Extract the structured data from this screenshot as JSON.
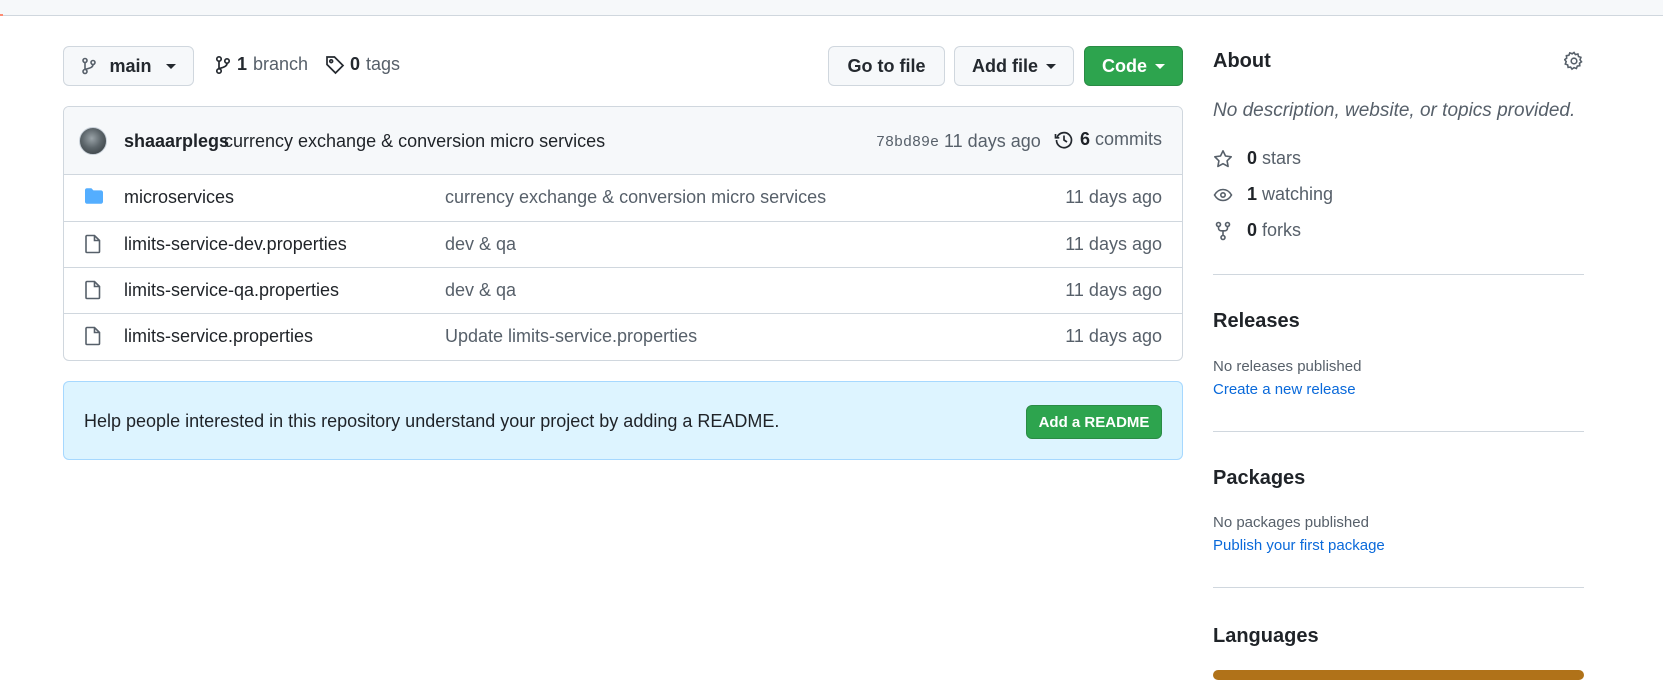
{
  "toolbar": {
    "branch_button": "main",
    "branches_count": "1",
    "branches_label": "branch",
    "tags_count": "0",
    "tags_label": "tags",
    "go_to_file": "Go to file",
    "add_file": "Add file",
    "code": "Code"
  },
  "commit": {
    "author": "shaaarplegs",
    "message": "currency exchange & conversion micro services",
    "sha": "78bd89e",
    "time": "11 days ago",
    "commits_count": "6",
    "commits_label": "commits"
  },
  "files": [
    {
      "name": "microservices",
      "type": "folder",
      "message": "currency exchange & conversion micro services",
      "time": "11 days ago"
    },
    {
      "name": "limits-service-dev.properties",
      "type": "file",
      "message": "dev & qa",
      "time": "11 days ago"
    },
    {
      "name": "limits-service-qa.properties",
      "type": "file",
      "message": "dev & qa",
      "time": "11 days ago"
    },
    {
      "name": "limits-service.properties",
      "type": "file",
      "message": "Update limits-service.properties",
      "time": "11 days ago"
    }
  ],
  "readme_banner": {
    "text": "Help people interested in this repository understand your project by adding a README.",
    "button": "Add a README"
  },
  "sidebar": {
    "about_title": "About",
    "about_desc": "No description, website, or topics provided.",
    "stars_count": "0",
    "stars_label": "stars",
    "watching_count": "1",
    "watching_label": "watching",
    "forks_count": "0",
    "forks_label": "forks",
    "releases_title": "Releases",
    "releases_text": "No releases published",
    "releases_link": "Create a new release",
    "packages_title": "Packages",
    "packages_text": "No packages published",
    "packages_link": "Publish your first package",
    "languages_title": "Languages"
  },
  "colors": {
    "accent_green": "#2da44e",
    "folder_blue": "#54aeff",
    "link_blue": "#0969da",
    "language_bar": "#b07219"
  },
  "icons": [
    "branch-icon",
    "tag-icon",
    "history-icon",
    "folder-icon",
    "file-icon",
    "gear-icon",
    "star-icon",
    "eye-icon",
    "fork-icon"
  ]
}
